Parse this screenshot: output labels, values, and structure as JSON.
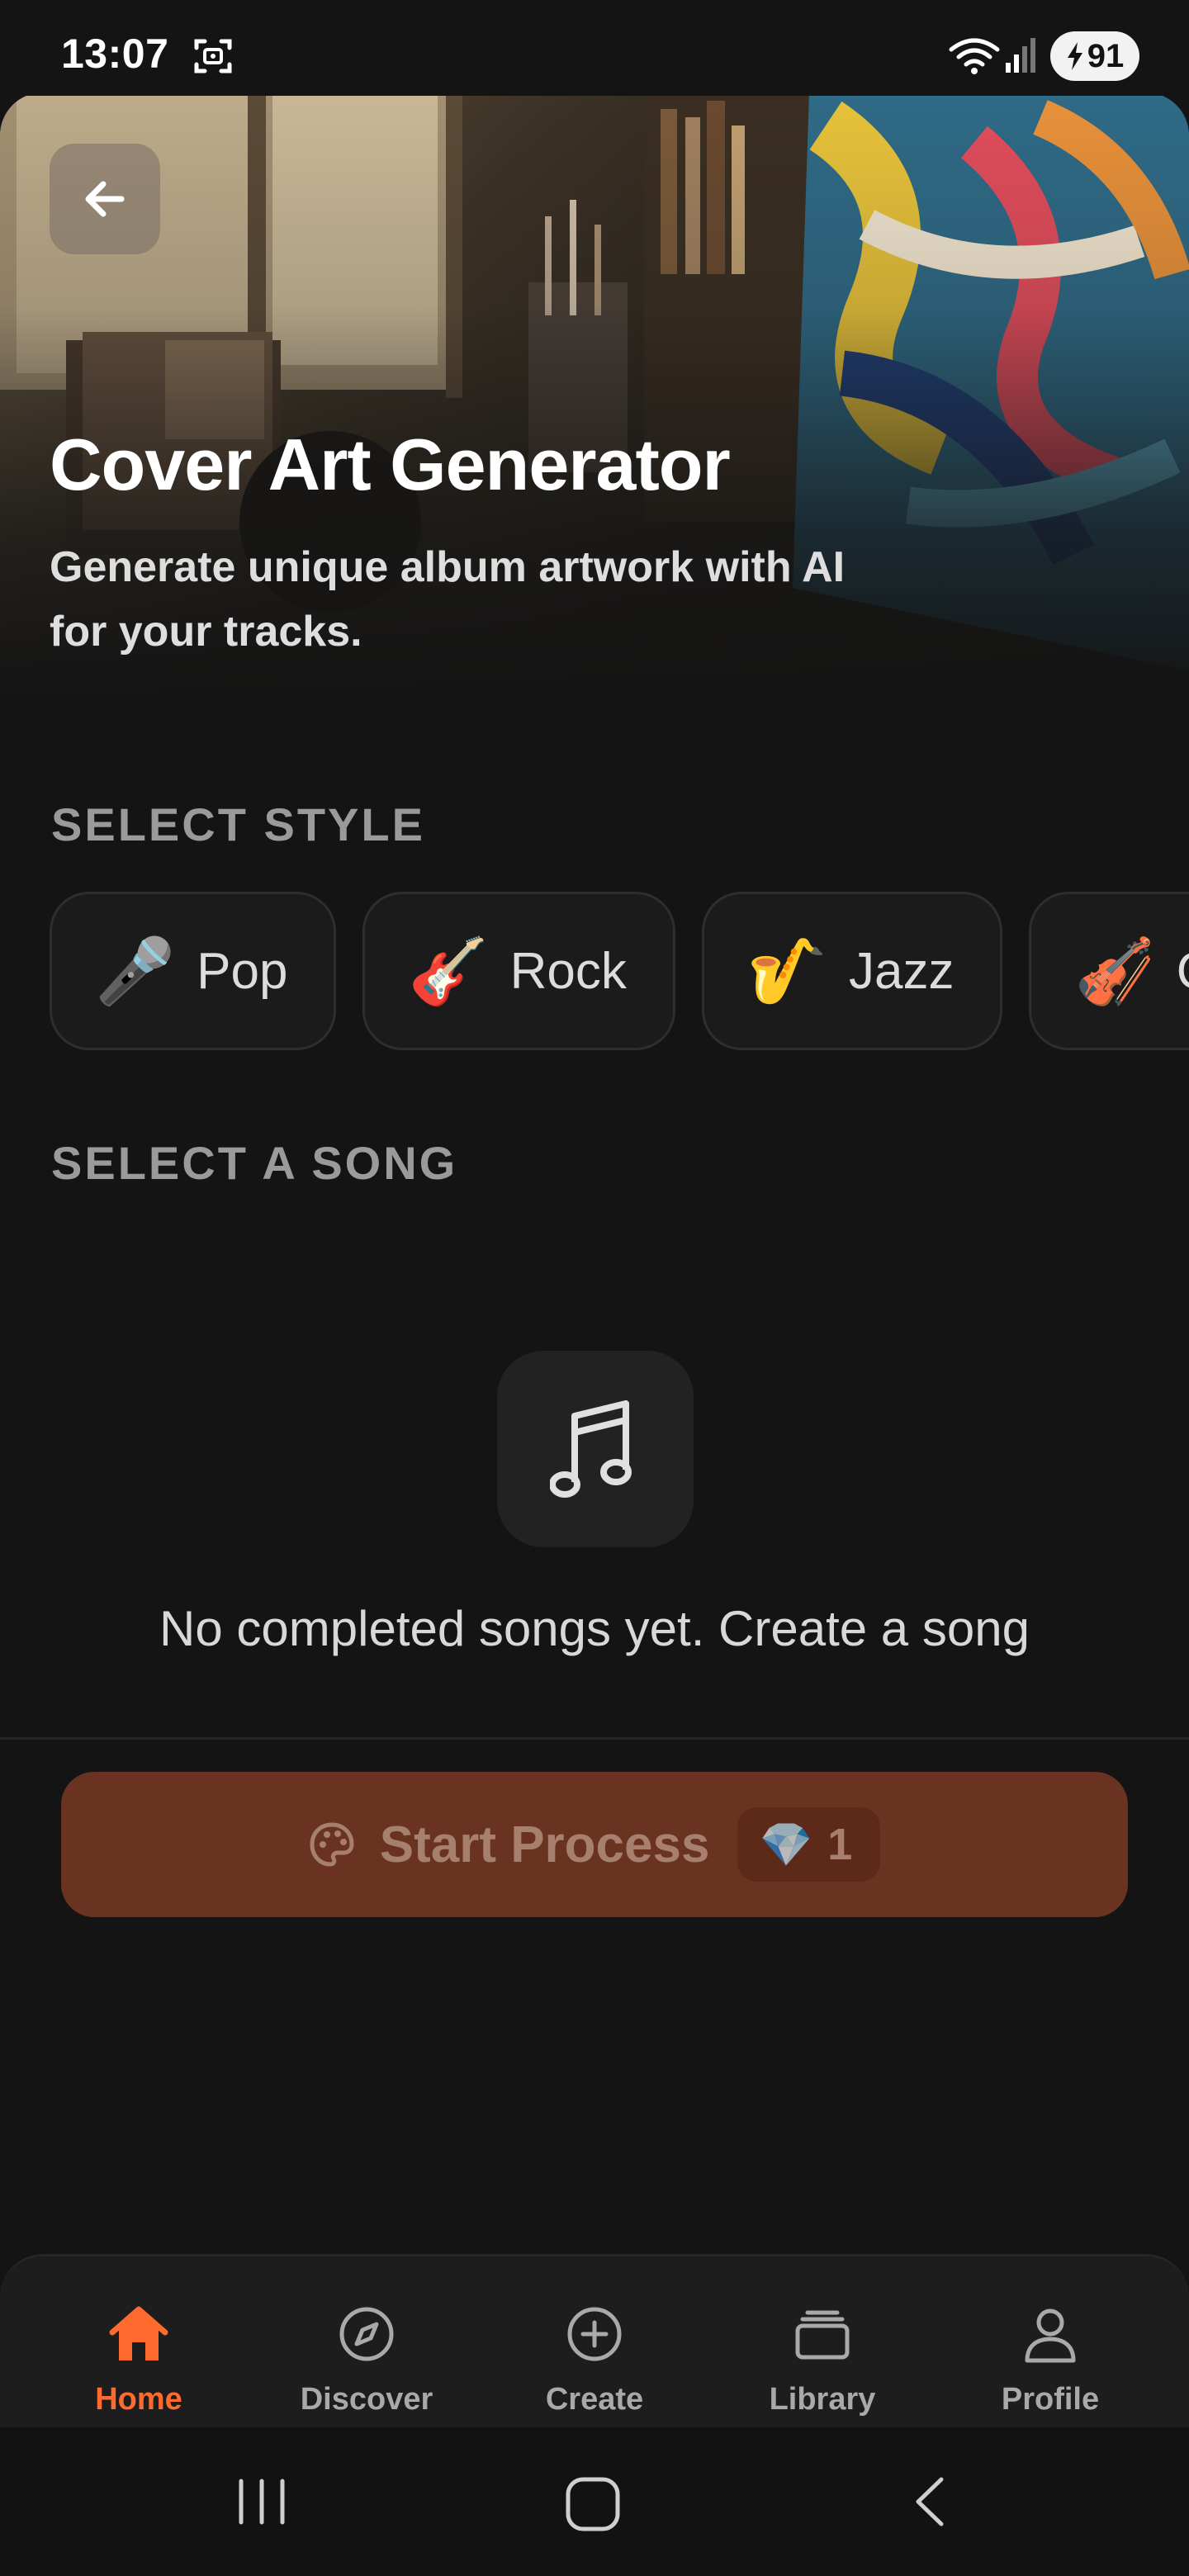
{
  "status_bar": {
    "time": "13:07",
    "battery": "91"
  },
  "hero": {
    "title": "Cover Art Generator",
    "subtitle": "Generate unique album artwork with AI for your tracks."
  },
  "style_section": {
    "label": "SELECT STYLE",
    "styles": [
      {
        "emoji": "🎤",
        "label": "Pop"
      },
      {
        "emoji": "🎸",
        "label": "Rock"
      },
      {
        "emoji": "🎷",
        "label": "Jazz"
      },
      {
        "emoji": "🎻",
        "label": "C"
      }
    ]
  },
  "song_section": {
    "label": "SELECT A SONG",
    "empty_message": "No completed songs yet. Create a song"
  },
  "start_button": {
    "label": "Start Process",
    "cost_icon": "💎",
    "cost": "1"
  },
  "bottom_nav": {
    "items": [
      {
        "label": "Home",
        "icon": "home-icon",
        "active": true
      },
      {
        "label": "Discover",
        "icon": "compass-icon",
        "active": false
      },
      {
        "label": "Create",
        "icon": "plus-circle-icon",
        "active": false
      },
      {
        "label": "Library",
        "icon": "library-icon",
        "active": false
      },
      {
        "label": "Profile",
        "icon": "person-icon",
        "active": false
      }
    ]
  },
  "colors": {
    "accent": "#ff6a2e",
    "background": "#141414",
    "start_button_bg": "#6a3220"
  }
}
